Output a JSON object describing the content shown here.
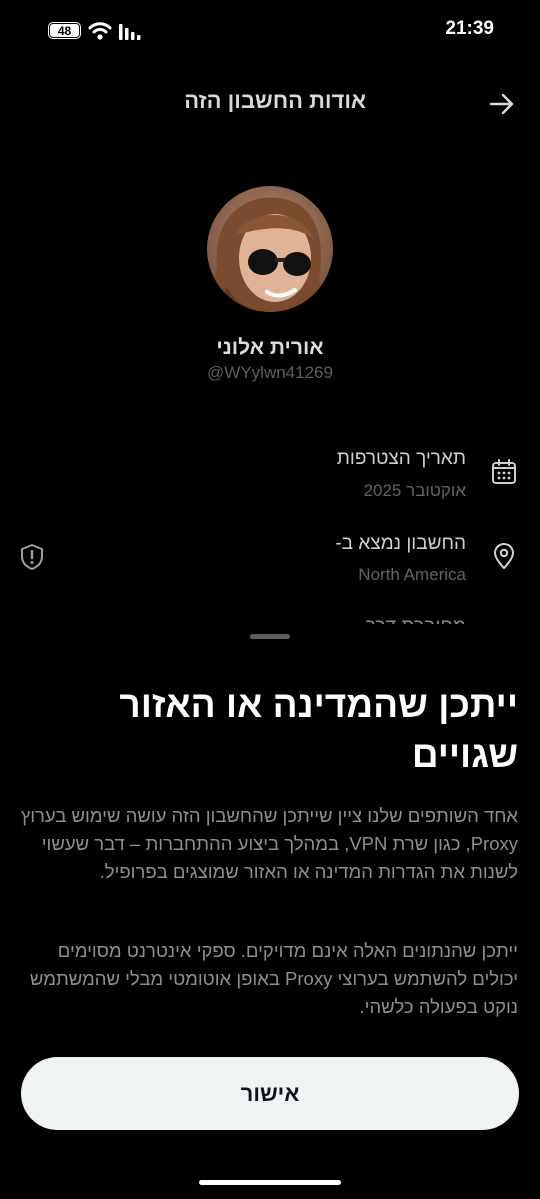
{
  "status_bar": {
    "battery_level": "48",
    "time": "21:39",
    "icons": [
      "battery-icon",
      "wifi-icon",
      "signal-icon"
    ]
  },
  "header": {
    "title": "אודות החשבון הזה",
    "back_icon": "arrow-right-icon"
  },
  "profile": {
    "display_name": "אורית אלוני",
    "handle": "@WYylwn41269"
  },
  "info": {
    "joined_label": "תאריך הצטרפות",
    "joined_value": "אוקטובר 2025",
    "location_label": "החשבון נמצא ב-",
    "location_value": "North America",
    "partial_row": "מחוברת דרך"
  },
  "sheet": {
    "title": "ייתכן שהמדינה או האזור שגויים",
    "paragraph1": "אחד השותפים שלנו ציין שייתכן שהחשבון הזה עושה שימוש בערוץ Proxy, כגון שרת VPN, במהלך ביצוע ההתחברות – דבר שעשוי לשנות את הגדרות המדינה או האזור שמוצגים בפרופיל.",
    "paragraph2": "ייתכן שהנתונים האלה אינם מדויקים. ספקי אינטרנט מסוימים יכולים להשתמש בערוצי Proxy באופן אוטומטי מבלי שהמשתמש נוקט בפעולה כלשהי.",
    "confirm_label": "אישור"
  },
  "colors": {
    "background": "#000000",
    "button_bg": "#eff3f4",
    "muted_text": "#8b9094"
  }
}
